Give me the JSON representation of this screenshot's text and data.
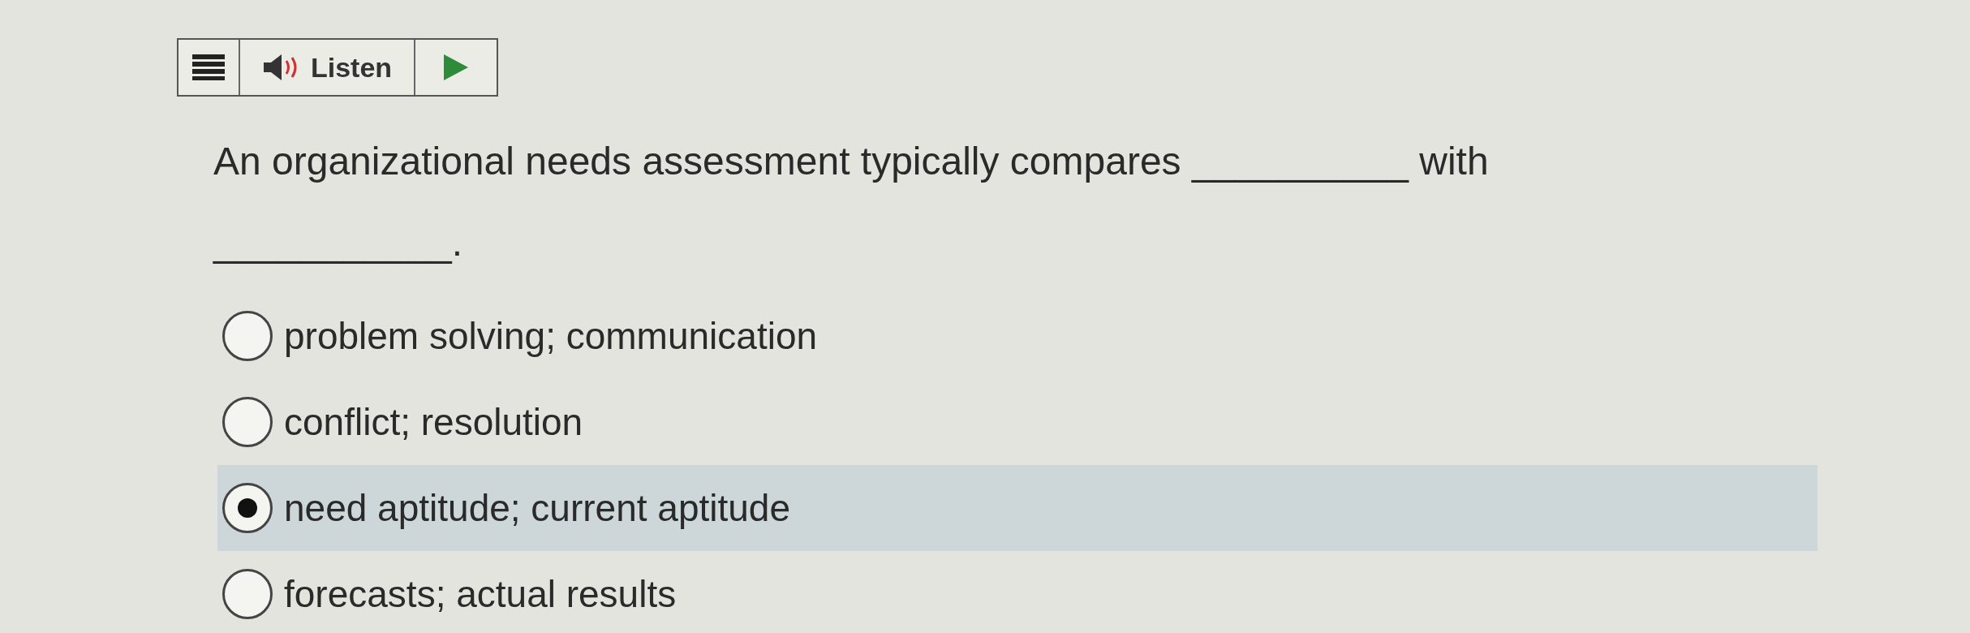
{
  "toolbar": {
    "listen_label": "Listen"
  },
  "question": {
    "text": "An organizational needs assessment typically compares __________ with ___________."
  },
  "options": [
    {
      "label": "problem solving; communication",
      "selected": false
    },
    {
      "label": "conflict; resolution",
      "selected": false
    },
    {
      "label": "need aptitude; current aptitude",
      "selected": true
    },
    {
      "label": "forecasts; actual results",
      "selected": false
    }
  ]
}
